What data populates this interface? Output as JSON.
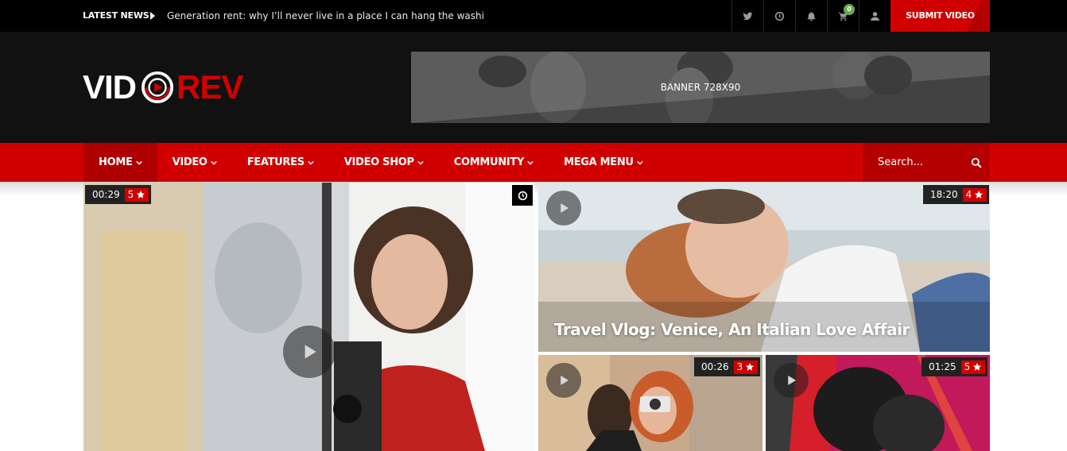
{
  "topbar": {
    "latest_label": "LATEST NEWS",
    "latest_headline": "Generation rent: why I’ll never live in a place I can hang the washi...",
    "icons": [
      "twitter-icon",
      "clock-icon",
      "bell-icon",
      "cart-icon",
      "user-icon"
    ],
    "cart_count": "0",
    "submit_label": "SUBMIT VIDEO",
    "cart_badge_color": "#6aa84f"
  },
  "header": {
    "logo_left": "VID",
    "logo_right": "REV",
    "banner_label": "BANNER 728X90"
  },
  "nav": {
    "items": [
      {
        "label": "HOME",
        "active": true
      },
      {
        "label": "VIDEO"
      },
      {
        "label": "FEATURES"
      },
      {
        "label": "VIDEO SHOP"
      },
      {
        "label": "COMMUNITY"
      },
      {
        "label": "MEGA MENU"
      }
    ],
    "search_placeholder": "Search..."
  },
  "videos": [
    {
      "duration": "00:29",
      "rating": "5",
      "title": ""
    },
    {
      "duration": "18:20",
      "rating": "4",
      "title": "Travel Vlog: Venice, An Italian Love Affair"
    },
    {
      "duration": "00:26",
      "rating": "3",
      "title": ""
    },
    {
      "duration": "01:25",
      "rating": "5",
      "title": ""
    }
  ],
  "colors": {
    "brand_red": "#d10000",
    "nav_active": "#ae0000",
    "topbar_bg": "#000000",
    "header_bg": "#111111"
  }
}
